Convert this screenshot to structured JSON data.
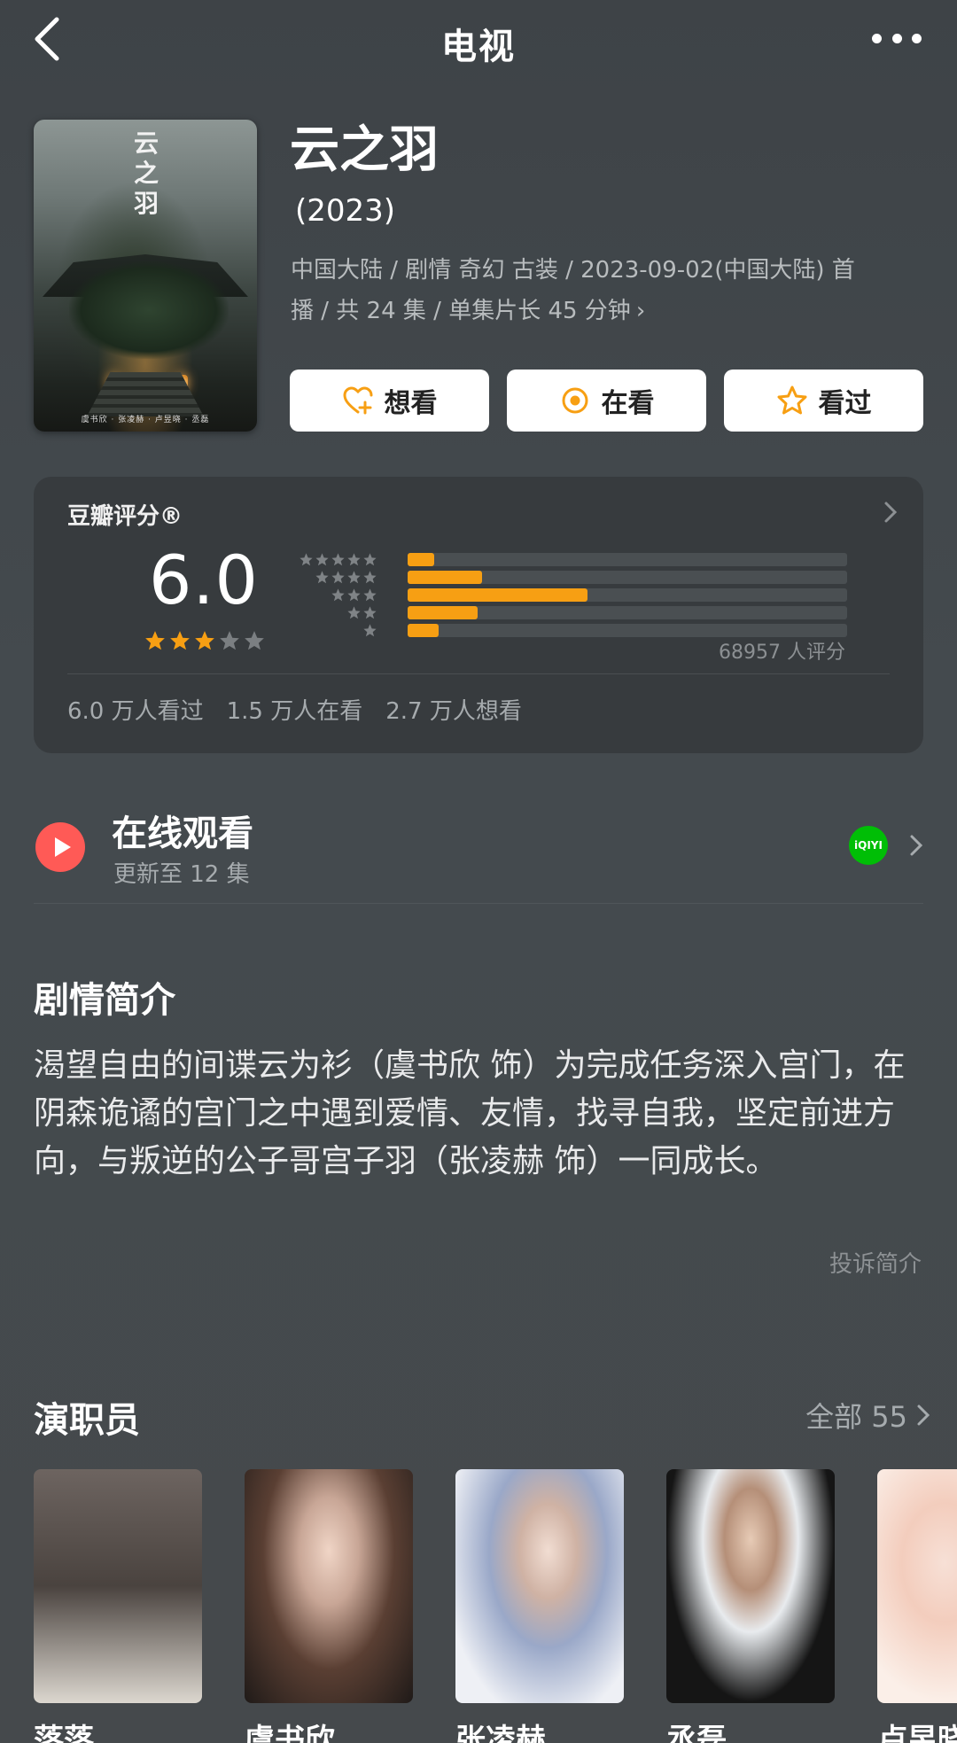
{
  "topbar": {
    "title": "电视"
  },
  "poster": {
    "title_vertical": "云之羽",
    "credits": "虞书欣 · 张凌赫 · 卢昱晓 · 丞磊"
  },
  "show": {
    "title": "云之羽",
    "year": "(2023)",
    "meta_line1": "中国大陆 / 剧情 奇幻 古装 / 2023-09-02(中国大陆) 首",
    "meta_line2": "播 / 共 24 集 / 单集片长 45 分钟",
    "chevron": "›"
  },
  "actions": {
    "want_label": "想看",
    "watching_label": "在看",
    "watched_label": "看过"
  },
  "colors": {
    "accent": "#f79f13",
    "play": "#ff5a56",
    "iqiyi": "#00be06"
  },
  "rating": {
    "label": "豆瓣评分®",
    "score": "6.0",
    "stars_filled": 3,
    "stars_total": 5,
    "distribution": [
      {
        "stars": 5,
        "fraction": 0.06
      },
      {
        "stars": 4,
        "fraction": 0.17
      },
      {
        "stars": 3,
        "fraction": 0.41
      },
      {
        "stars": 2,
        "fraction": 0.16
      },
      {
        "stars": 1,
        "fraction": 0.07
      }
    ],
    "count": "68957 人评分",
    "stats": [
      "6.0 万人看过",
      "1.5 万人在看",
      "2.7 万人想看"
    ]
  },
  "online": {
    "title": "在线观看",
    "subtitle": "更新至 12 集",
    "provider_icon": "iqiyi-icon",
    "provider_text": "iQIYI"
  },
  "synopsis": {
    "title": "剧情简介",
    "text": "渴望自由的间谍云为衫（虞书欣 饰）为完成任务深入宫门，在阴森诡谲的宫门之中遇到爱情、友情，找寻自我，坚定前进方向，与叛逆的公子哥宫子羽（张凌赫 饰）一同成长。",
    "report": "投诉简介"
  },
  "cast": {
    "title": "演职员",
    "all_label": "全部 55",
    "members": [
      {
        "name": "落落"
      },
      {
        "name": "虞书欣"
      },
      {
        "name": "张凌赫"
      },
      {
        "name": "丞磊"
      },
      {
        "name": "卢昱晓"
      }
    ]
  }
}
